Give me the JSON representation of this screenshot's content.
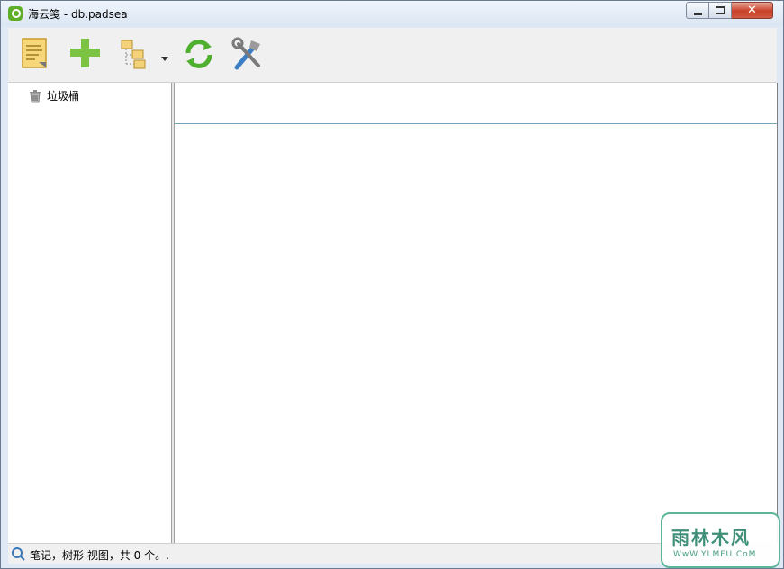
{
  "window": {
    "title": "海云笺 - db.padsea",
    "controls": {
      "minimize": "minimize",
      "maximize": "maximize",
      "close": "✕"
    }
  },
  "toolbar": {
    "buttons": [
      {
        "id": "new-note",
        "icon": "note-icon"
      },
      {
        "id": "add",
        "icon": "plus-icon"
      },
      {
        "id": "view-tree",
        "icon": "folder-tree-icon",
        "has_dropdown": true
      },
      {
        "id": "sync",
        "icon": "refresh-icon"
      },
      {
        "id": "tools",
        "icon": "tools-icon"
      }
    ]
  },
  "sidebar": {
    "items": [
      {
        "label": "垃圾桶",
        "icon": "trash-icon"
      }
    ]
  },
  "status": {
    "text": "笔记，树形 视图，共 0 个。."
  },
  "watermark": {
    "main": "雨林木风",
    "sub": "WwW.YLMFU.CoM"
  },
  "colors": {
    "plus": "#7cc243",
    "refresh": "#4fb030",
    "divider": "#76a3b8",
    "close_button": "#c7402a"
  }
}
